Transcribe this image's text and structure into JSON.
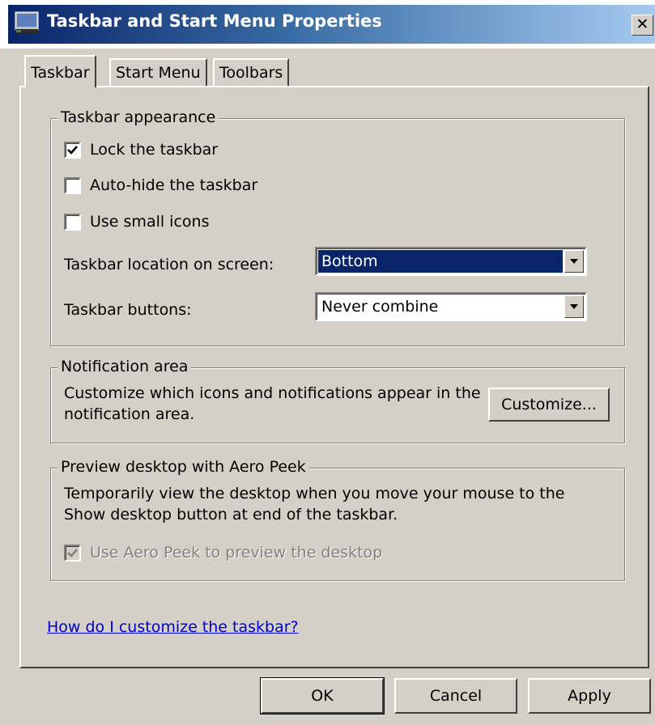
{
  "window": {
    "title": "Taskbar and Start Menu Properties",
    "close_glyph": "✕"
  },
  "tabs": [
    {
      "label": "Taskbar",
      "active": true
    },
    {
      "label": "Start Menu",
      "active": false
    },
    {
      "label": "Toolbars",
      "active": false
    }
  ],
  "appearance": {
    "legend": "Taskbar appearance",
    "lock_label": "Lock the taskbar",
    "lock_checked": true,
    "autohide_label": "Auto-hide the taskbar",
    "autohide_checked": false,
    "small_icons_label": "Use small icons",
    "small_icons_checked": false,
    "location_label": "Taskbar location on screen:",
    "location_value": "Bottom",
    "buttons_label": "Taskbar buttons:",
    "buttons_value": "Never combine"
  },
  "notification": {
    "legend": "Notification area",
    "description": "Customize which icons and notifications appear in the notification area.",
    "customize_label": "Customize..."
  },
  "peek": {
    "legend": "Preview desktop with Aero Peek",
    "description": "Temporarily view the desktop when you move your mouse to the Show desktop button at end of the taskbar.",
    "checkbox_label": "Use Aero Peek to preview the desktop",
    "checkbox_checked": true,
    "checkbox_enabled": false
  },
  "help_link": "How do I customize the taskbar?",
  "footer": {
    "ok_label": "OK",
    "cancel_label": "Cancel",
    "apply_label": "Apply"
  },
  "colors": {
    "dialog_bg": "#d4d0c8",
    "title_gradient_start": "#0a246a",
    "title_gradient_end": "#a6caf0",
    "selection": "#0a246a",
    "link": "#0000cc"
  },
  "icons": {
    "title": "taskbar-window-icon",
    "close": "close-icon",
    "checkmark": "checkmark-icon",
    "dropdown": "chevron-down-icon"
  }
}
